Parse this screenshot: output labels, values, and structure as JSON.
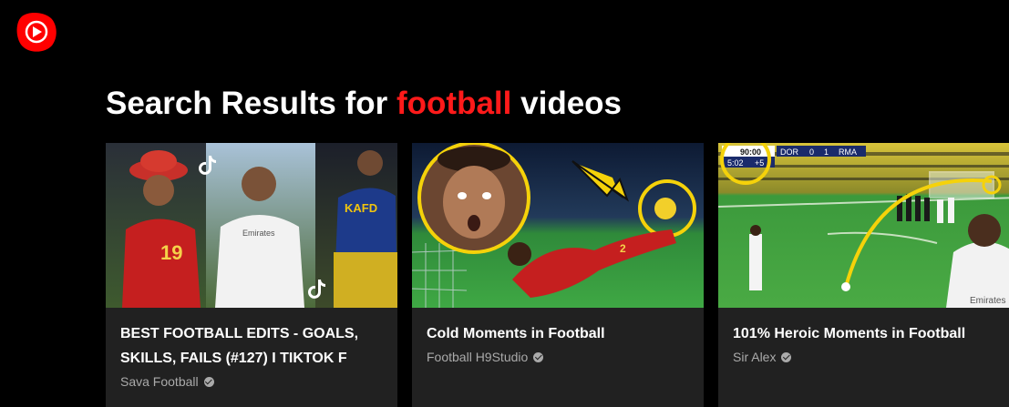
{
  "logo": {
    "icon": "youtube-play-icon",
    "color": "#ff0000"
  },
  "heading": {
    "prefix": "Search Results for",
    "keyword": "football",
    "suffix": "videos",
    "keyword_color": "#ff1a1a"
  },
  "results": [
    {
      "title": "BEST FOOTBALL EDITS - GOALS, SKILLS, FAILS (#127) I TIKTOK F",
      "channel": "Sava Football",
      "verified_icon": "verified-check-icon"
    },
    {
      "title": "Cold Moments in Football",
      "channel": "Football H9Studio",
      "verified_icon": "verified-check-icon"
    },
    {
      "title": "101% Heroic Moments in Football",
      "channel": "Sir Alex",
      "verified_icon": "verified-check-icon",
      "scoreboard": {
        "clock": "90:00",
        "extra_clock": "5:02",
        "added_time": "+5",
        "home": "DOR",
        "home_score": "0",
        "away_score": "1",
        "away": "RMA"
      }
    }
  ]
}
